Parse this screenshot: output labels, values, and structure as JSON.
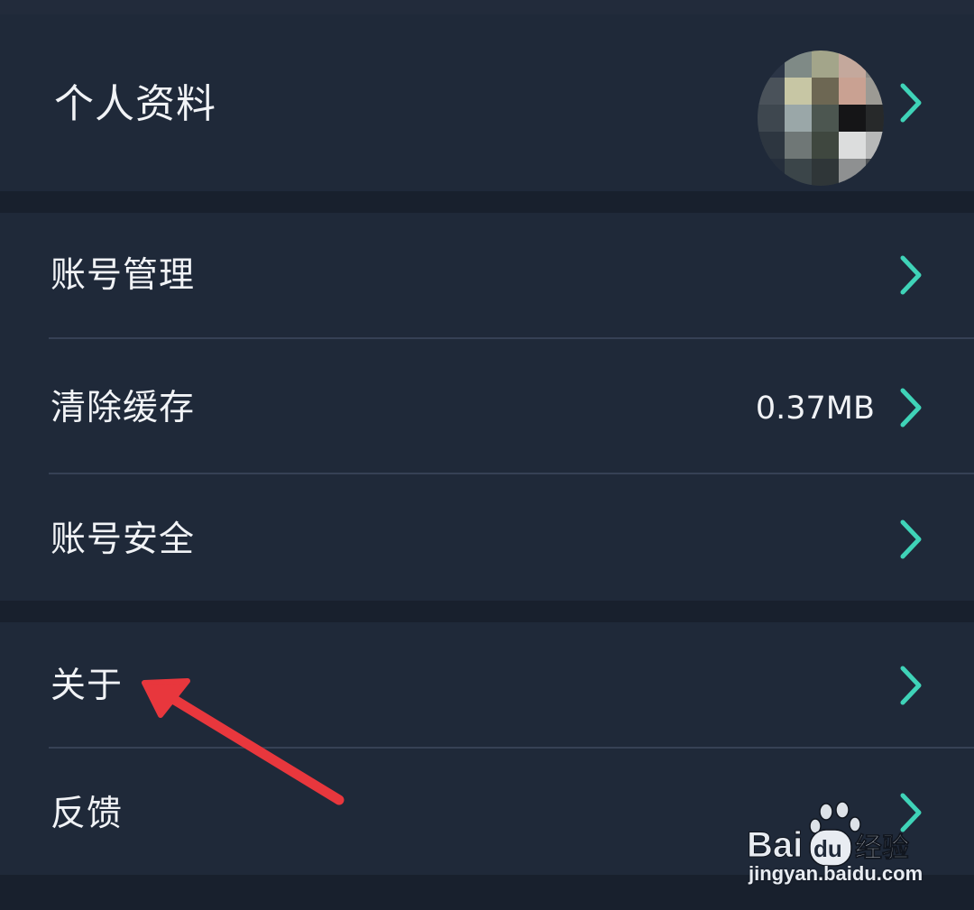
{
  "profile": {
    "label": "个人资料",
    "avatar_icon": "pixelated-avatar-icon",
    "chevron_icon": "chevron-right-icon"
  },
  "account_section": {
    "items": [
      {
        "label": "账号管理",
        "value": ""
      },
      {
        "label": "清除缓存",
        "value": "0.37MB"
      },
      {
        "label": "账号安全",
        "value": ""
      }
    ]
  },
  "about_section": {
    "items": [
      {
        "label": "关于",
        "value": ""
      },
      {
        "label": "反馈",
        "value": ""
      }
    ]
  },
  "annotation": {
    "type": "arrow",
    "color": "#e8373d",
    "points_to": "关于"
  },
  "watermark": {
    "brand": "Bai du 经验",
    "url": "jingyan.baidu.com"
  },
  "colors": {
    "background": "#18202d",
    "card": "#1f2939",
    "divider": "#364155",
    "text": "#f1f3f6",
    "accent_chevron": "#3fd3b8"
  }
}
